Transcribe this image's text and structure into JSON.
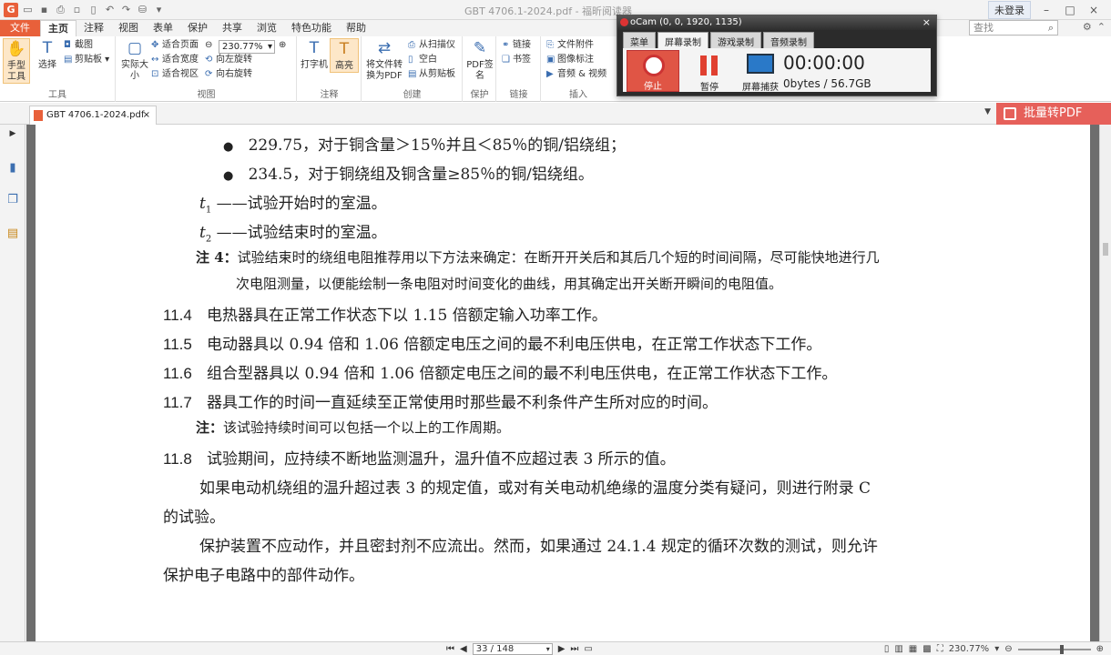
{
  "titlebar": {
    "doc_title": "GBT 4706.1-2024.pdf - 福昕阅读器",
    "login": "未登录"
  },
  "menu": {
    "file": "文件",
    "tabs": [
      "主页",
      "注释",
      "视图",
      "表单",
      "保护",
      "共享",
      "浏览",
      "特色功能",
      "帮助"
    ],
    "search_placeholder": "查找"
  },
  "ribbon": {
    "hand": "手型工具",
    "select": "选择",
    "screenshot": "截图",
    "clipboard": "剪贴板",
    "tools_label": "工具",
    "actual_size": "实际大小",
    "fit_page": "适合页面",
    "fit_width": "适合宽度",
    "fit_view": "适合视区",
    "zoom": "230.77%",
    "rotate_left": "向左旋转",
    "rotate_right": "向右旋转",
    "view_label": "视图",
    "typewriter": "打字机",
    "highlight": "高亮",
    "annot_label": "注释",
    "convert": "将文件转换为PDF",
    "from_scanner": "从扫描仪",
    "blank": "空白",
    "from_clipboard": "从剪贴板",
    "create_label": "创建",
    "pdf_sign": "PDF签名",
    "protect_label": "保护",
    "link": "链接",
    "bookmark": "书签",
    "links_label": "链接",
    "attachment": "文件附件",
    "image_annot": "图像标注",
    "audio_video": "音频 & 视频",
    "insert_label": "插入"
  },
  "ocam": {
    "title": "oCam (0, 0, 1920, 1135)",
    "tabs": [
      "菜单",
      "屏幕录制",
      "游戏录制",
      "音频录制"
    ],
    "stop": "停止",
    "pause": "暂停",
    "capture": "屏幕捕获",
    "time": "00:00:00",
    "size": "0bytes / 56.7GB"
  },
  "doctab": {
    "name": "GBT 4706.1-2024.pdf",
    "bulk": "批量转PDF"
  },
  "document": {
    "bullet1": "229.75，对于铜含量＞15％并且＜85％的铜/铝绕组；",
    "bullet2": "234.5，对于铜绕组及铜含量≥85％的铜/铝绕组。",
    "t1_sym": "t",
    "t1_sub": "1",
    "t1_text": "——试验开始时的室温。",
    "t2_sym": "t",
    "t2_sub": "2",
    "t2_text": "——试验结束时的室温。",
    "note4_label": "注 4：",
    "note4_line1": "试验结束时的绕组电阻推荐用以下方法来确定：在断开开关后和其后几个短的时间间隔，尽可能快地进行几",
    "note4_line2": "次电阻测量，以便能绘制一条电阻对时间变化的曲线，用其确定出开关断开瞬间的电阻值。",
    "c114_num": "11.4",
    "c114": "电热器具在正常工作状态下以 1.15 倍额定输入功率工作。",
    "c115_num": "11.5",
    "c115": "电动器具以 0.94 倍和 1.06 倍额定电压之间的最不利电压供电，在正常工作状态下工作。",
    "c116_num": "11.6",
    "c116": "组合型器具以 0.94 倍和 1.06 倍额定电压之间的最不利电压供电，在正常工作状态下工作。",
    "c117_num": "11.7",
    "c117": "器具工作的时间一直延续至正常使用时那些最不利条件产生所对应的时间。",
    "note_label": "注：",
    "note_text": "该试验持续时间可以包括一个以上的工作周期。",
    "c118_num": "11.8",
    "c118": "试验期间，应持续不断地监测温升，温升值不应超过表 3 所示的值。",
    "para1_line1": "如果电动机绕组的温升超过表 3 的规定值，或对有关电动机绝缘的温度分类有疑问，则进行附录 C",
    "para1_line2": "的试验。",
    "para2_line1": "保护装置不应动作，并且密封剂不应流出。然而，如果通过 24.1.4 规定的循环次数的测试，则允许",
    "para2_line2": "保护电子电路中的部件动作。"
  },
  "status": {
    "page": "33 / 148",
    "zoom": "230.77%"
  }
}
